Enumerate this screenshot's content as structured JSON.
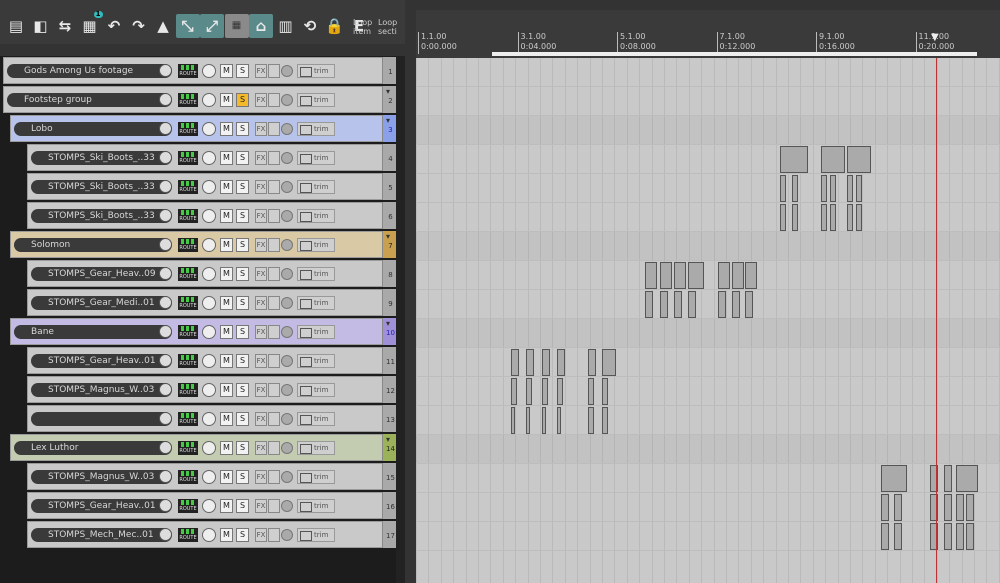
{
  "toolbar": {
    "buttons": [
      {
        "icon": "new-project-icon",
        "glyph": "▤"
      },
      {
        "icon": "open-project-icon",
        "glyph": "◧"
      },
      {
        "icon": "save-project-icon",
        "glyph": "⇆"
      },
      {
        "icon": "project-settings-icon",
        "glyph": "▦",
        "badge": "1"
      },
      {
        "icon": "undo-icon",
        "glyph": "↶"
      },
      {
        "icon": "redo-icon",
        "glyph": "↷"
      },
      {
        "icon": "metronome-icon",
        "glyph": "▲"
      },
      {
        "icon": "auto-crossfade-icon",
        "glyph": "⤡"
      },
      {
        "icon": "ripple-edit-icon",
        "glyph": "⤢"
      },
      {
        "icon": "grid-icon",
        "glyph": "▦"
      },
      {
        "icon": "snap-icon",
        "glyph": "⌂"
      },
      {
        "icon": "locking-icon",
        "glyph": "▥"
      },
      {
        "icon": "loop-icon",
        "glyph": "⟲"
      },
      {
        "icon": "lock-icon",
        "glyph": "🔒"
      },
      {
        "icon": "edit-mode-icon",
        "glyph": "E"
      }
    ],
    "loop_items_label": "Loop item",
    "loop_section_label": "Loop secti"
  },
  "tracks": [
    {
      "number": "1",
      "name": "Gods Among Us footage",
      "indent": 0,
      "folder": false,
      "solo": false,
      "num_style": ""
    },
    {
      "number": "2",
      "name": "Footstep group",
      "indent": 0,
      "folder": true,
      "solo": true,
      "num_style": ""
    },
    {
      "number": "3",
      "name": "Lobo",
      "indent": 1,
      "folder": true,
      "solo": false,
      "num_style": "sel"
    },
    {
      "number": "4",
      "name": "STOMPS_Ski_Boots_..33",
      "indent": 2,
      "folder": false,
      "solo": false,
      "num_style": ""
    },
    {
      "number": "5",
      "name": "STOMPS_Ski_Boots_..33",
      "indent": 2,
      "folder": false,
      "solo": false,
      "num_style": ""
    },
    {
      "number": "6",
      "name": "STOMPS_Ski_Boots_..33",
      "indent": 2,
      "folder": false,
      "solo": false,
      "num_style": ""
    },
    {
      "number": "7",
      "name": "Solomon",
      "indent": 1,
      "folder": true,
      "solo": false,
      "num_style": "sel3"
    },
    {
      "number": "8",
      "name": "STOMPS_Gear_Heav..09",
      "indent": 2,
      "folder": false,
      "solo": false,
      "num_style": ""
    },
    {
      "number": "9",
      "name": "STOMPS_Gear_Medi..01",
      "indent": 2,
      "folder": false,
      "solo": false,
      "num_style": ""
    },
    {
      "number": "10",
      "name": "Bane",
      "indent": 1,
      "folder": true,
      "solo": false,
      "num_style": "sel4"
    },
    {
      "number": "11",
      "name": "STOMPS_Gear_Heav..01",
      "indent": 2,
      "folder": false,
      "solo": false,
      "num_style": ""
    },
    {
      "number": "12",
      "name": "STOMPS_Magnus_W..03",
      "indent": 2,
      "folder": false,
      "solo": false,
      "num_style": ""
    },
    {
      "number": "13",
      "name": "",
      "indent": 2,
      "folder": false,
      "solo": false,
      "num_style": ""
    },
    {
      "number": "14",
      "name": "Lex Luthor",
      "indent": 1,
      "folder": true,
      "solo": false,
      "num_style": "sel2"
    },
    {
      "number": "15",
      "name": "STOMPS_Magnus_W..03",
      "indent": 2,
      "folder": false,
      "solo": false,
      "num_style": ""
    },
    {
      "number": "16",
      "name": "STOMPS_Gear_Heav..01",
      "indent": 2,
      "folder": false,
      "solo": false,
      "num_style": ""
    },
    {
      "number": "17",
      "name": "STOMPS_Mech_Mec..01",
      "indent": 2,
      "folder": false,
      "solo": false,
      "num_style": ""
    }
  ],
  "track_labels": {
    "route": "ROUTE",
    "mute": "M",
    "solo": "S",
    "fx": "FX",
    "trim": "trim"
  },
  "ruler": {
    "marks": [
      {
        "bar": "1.1.00",
        "time": "0:00.000"
      },
      {
        "bar": "3.1.00",
        "time": "0:04.000"
      },
      {
        "bar": "5.1.00",
        "time": "0:08.000"
      },
      {
        "bar": "7.1.00",
        "time": "0:12.000"
      },
      {
        "bar": "9.1.00",
        "time": "0:16.000"
      },
      {
        "bar": "11.1.00",
        "time": "0:20.000"
      }
    ]
  },
  "colors": {
    "lobo": "#8aa0e8",
    "solomon": "#c8a050",
    "bane": "#a090d8",
    "lex": "#9bb25a",
    "solo_on": "#f3b92b",
    "playhead": "#b33333"
  }
}
